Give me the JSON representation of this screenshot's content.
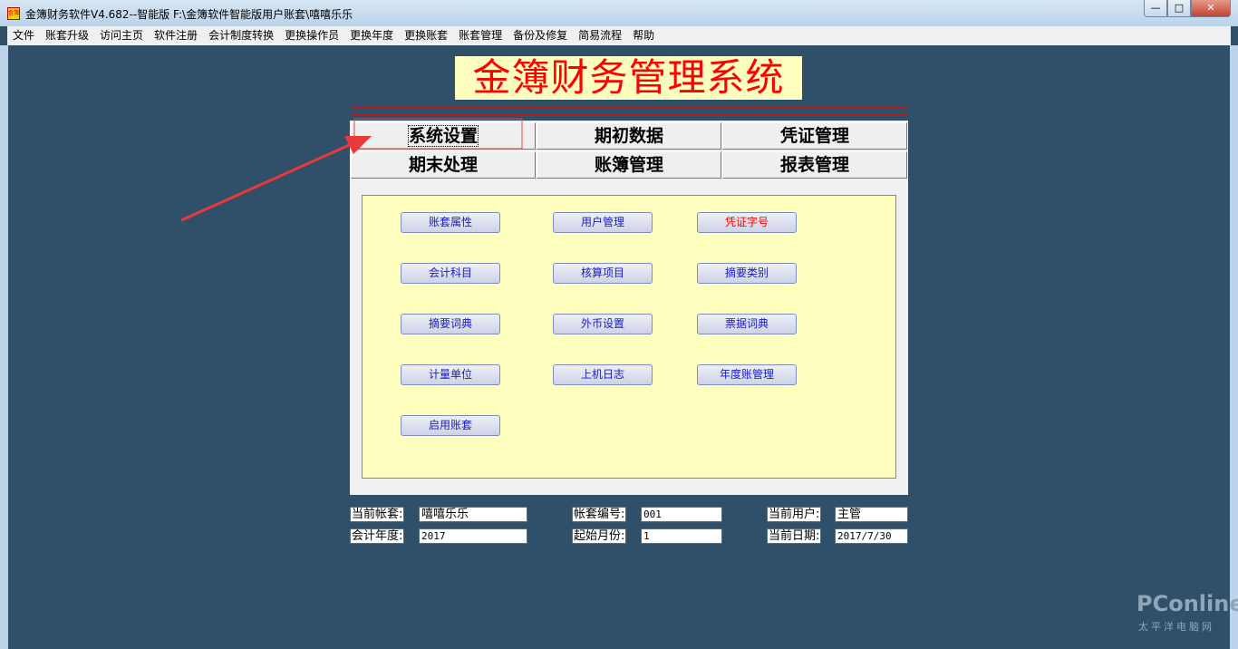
{
  "window": {
    "title": "金簿财务软件V4.682--智能版   F:\\金簿软件智能版用户账套\\嘻嘻乐乐",
    "icon_text": "金簿",
    "minimize": "—",
    "maximize": "□",
    "close": "✕"
  },
  "menu": [
    "文件",
    "账套升级",
    "访问主页",
    "软件注册",
    "会计制度转换",
    "更换操作员",
    "更换年度",
    "更换账套",
    "账套管理",
    "备份及修复",
    "简易流程",
    "帮助"
  ],
  "logo": "金簿财务管理系统",
  "modules": [
    "系统设置",
    "期初数据",
    "凭证管理",
    "期末处理",
    "账簿管理",
    "报表管理"
  ],
  "functions": [
    "账套属性",
    "用户管理",
    "凭证字号",
    "会计科目",
    "核算项目",
    "摘要类别",
    "摘要词典",
    "外币设置",
    "票据词典",
    "计量单位",
    "上机日志",
    "年度账管理",
    "启用账套"
  ],
  "info": {
    "current_book_label": "当前帐套:",
    "current_book": "嘻嘻乐乐",
    "book_no_label": "帐套编号:",
    "book_no": "001",
    "current_user_label": "当前用户:",
    "current_user": "主管",
    "year_label": "会计年度:",
    "year": "2017",
    "start_month_label": "起始月份:",
    "start_month": "1",
    "current_date_label": "当前日期:",
    "current_date": "2017/7/30"
  },
  "watermark": {
    "brand": "PConline",
    "sub": "太平洋电脑网"
  },
  "colors": {
    "background": "#2f5068",
    "logo_bg": "#ffffc0",
    "logo_text": "#ff0000",
    "function_text": "#1a1acc"
  }
}
